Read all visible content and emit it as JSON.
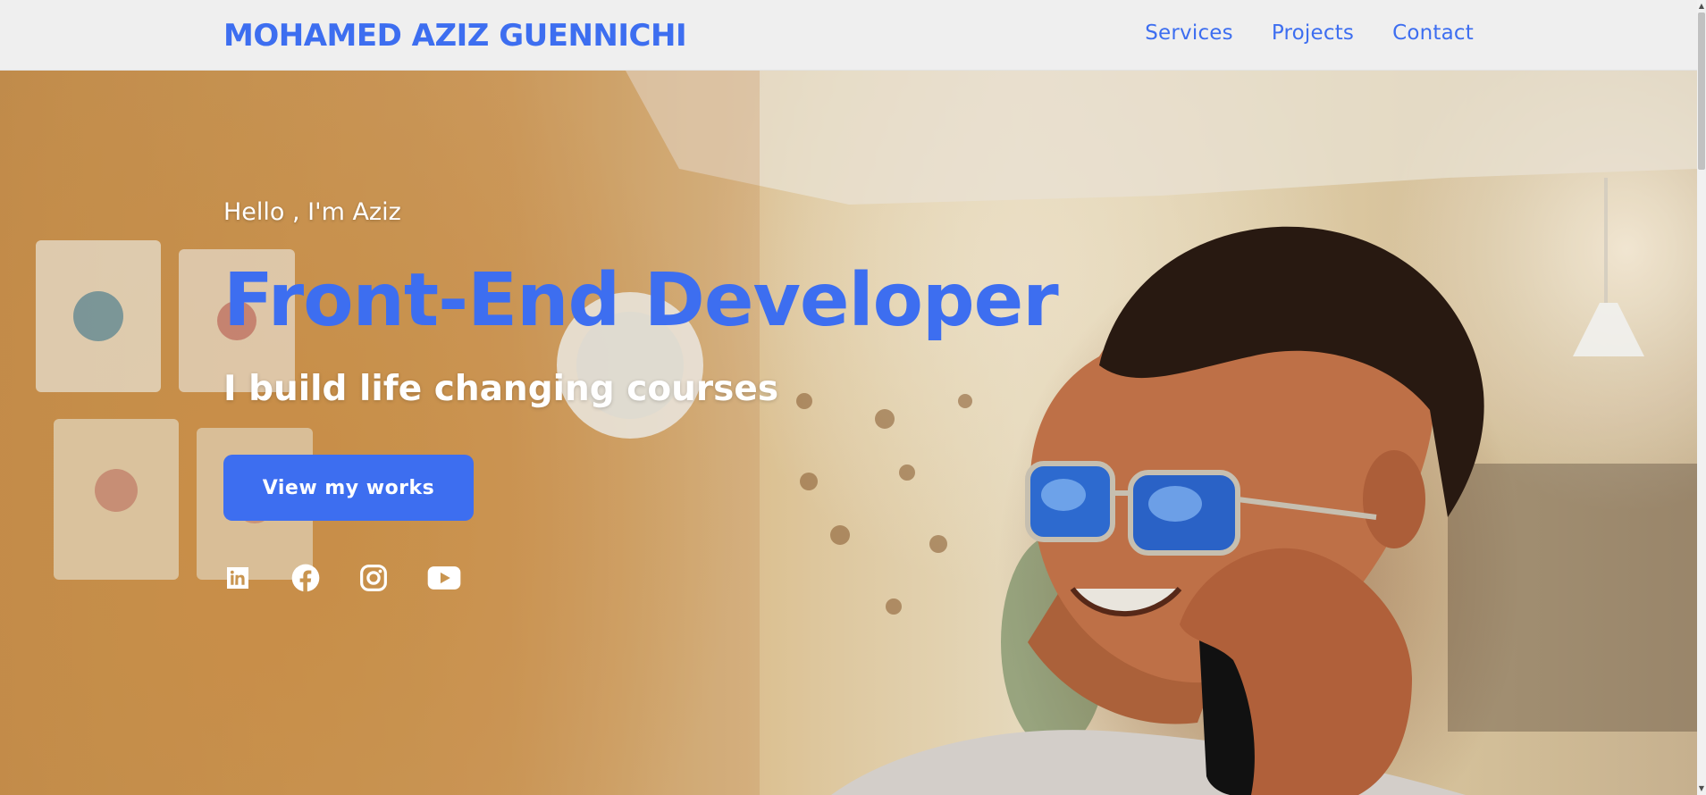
{
  "navbar": {
    "brand": "MOHAMED AZIZ GUENNICHI",
    "links": [
      {
        "label": "Services"
      },
      {
        "label": "Projects"
      },
      {
        "label": "Contact"
      }
    ]
  },
  "hero": {
    "greeting": "Hello , I'm Aziz",
    "role": "Front-End Developer",
    "tagline": "I build life changing courses",
    "cta_label": "View my works",
    "socials": [
      {
        "icon": "linkedin-icon"
      },
      {
        "icon": "facebook-icon"
      },
      {
        "icon": "instagram-icon"
      },
      {
        "icon": "youtube-icon"
      }
    ]
  },
  "colors": {
    "accent": "#3d6ef0",
    "nav_background": "#efefef",
    "text_light": "#ffffff"
  }
}
